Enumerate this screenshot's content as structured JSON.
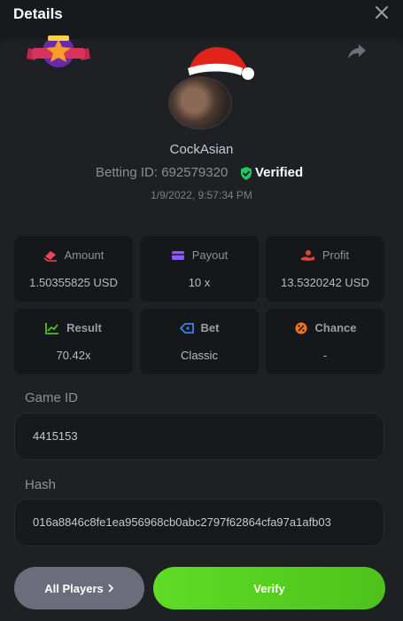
{
  "header": {
    "title": "Details"
  },
  "profile": {
    "username": "CockAsian",
    "betting_id": "Betting ID: 692579320",
    "verified": "Verified",
    "timestamp": "1/9/2022, 9:57:34 PM"
  },
  "stats": [
    {
      "label": "Amount",
      "value": "1.50355825 USD",
      "icon": "amount-icon",
      "color": "#e8465a"
    },
    {
      "label": "Payout",
      "value": "10 x",
      "icon": "payout-card-icon",
      "color": "#8b5cf6"
    },
    {
      "label": "Profit",
      "value": "13.5320242 USD",
      "icon": "profit-hand-icon",
      "color": "#e0443c"
    },
    {
      "label": "Result",
      "value": "70.42x",
      "icon": "result-chart-icon",
      "color": "#4ec21c"
    },
    {
      "label": "Bet",
      "value": "Classic",
      "icon": "bet-tag-icon",
      "color": "#3b82f6"
    },
    {
      "label": "Chance",
      "value": "-",
      "icon": "chance-percent-icon",
      "color": "#f97316"
    }
  ],
  "game": {
    "label": "Game ID",
    "value": "4415153"
  },
  "hash": {
    "label": "Hash",
    "value": "016a8846c8fe1ea956968cb0abc2797f62864cfa97a1afb03"
  },
  "actions": {
    "all_players": "All Players",
    "verify": "Verify"
  },
  "colors": {
    "accent_green": "#4ec21c",
    "verified_green": "#22c55e"
  }
}
